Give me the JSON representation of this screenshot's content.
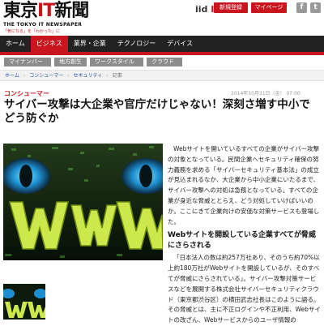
{
  "header": {
    "logo_main_a": "東京",
    "logo_main_it": "IT",
    "logo_main_b": "新聞",
    "logo_sub": "THE TOKYO IT NEWSPAPER",
    "logo_tagline": "「気になる」を「わかった」に",
    "iid_prefix": "iid",
    "iid_suffix": "ID",
    "register_label": "新規登録",
    "mypage_label": "マイページ",
    "facebook_glyph": "f",
    "twitter_glyph": "t"
  },
  "nav": {
    "items": [
      {
        "label": "ホーム"
      },
      {
        "label": "ビジネス"
      },
      {
        "label": "業界・企業"
      },
      {
        "label": "テクノロジー"
      },
      {
        "label": "デバイス"
      }
    ],
    "active_index": 1
  },
  "tags": [
    {
      "label": "マイナンバー"
    },
    {
      "label": "地方創生"
    },
    {
      "label": "ワークスタイル"
    },
    {
      "label": "クラウド"
    }
  ],
  "breadcrumb": [
    {
      "label": "ホーム"
    },
    {
      "label": "コンシューマー"
    },
    {
      "label": "セキュリティ"
    },
    {
      "label": "記事"
    }
  ],
  "article": {
    "category": "コンシューマー",
    "date": "2014年10月31日（金） 07:00",
    "title": "サイバー攻撃は大企業や官庁だけじゃない！深刻さ増す中小でどう防ぐか",
    "p1": "Webサイトを開いているすべての企業がサイバー攻撃の対象となっている。民間企業へセキュリティ確保の努力義務を求める「サイバーセキュリティ基本法」の成立が見込まれるなか、大企業から中小企業にいたるまで、サイバー攻撃への対処は急務となっている。すべての企業が身近な脅威ととらえ、どう対処していけばいいのか。ここにきて企業向けの安価な対策サービスも登場した。",
    "subhead": "Webサイトを開設している企業すべてが脅威にさらされる",
    "p2": "「日本法人の数は約257万社あり、そのうち約70%以上約180万社がWebサイトを開設しているが、そのすべてが脅威にさらされている」。サイバー攻撃対策サービスなどを展開する株式会社サイバーセキュリティクラウド（東京都渋谷区）の横田武志社長はこのように語る。その脅威とは、主に不正ログインや不正利用、Webサイトの改ざん、Webサービスからのユーザ情報の"
  },
  "colors": {
    "accent": "#c9151e",
    "nav_bg": "#222222",
    "tag_bg": "#8c8c8c",
    "link": "#1f4fa1"
  }
}
